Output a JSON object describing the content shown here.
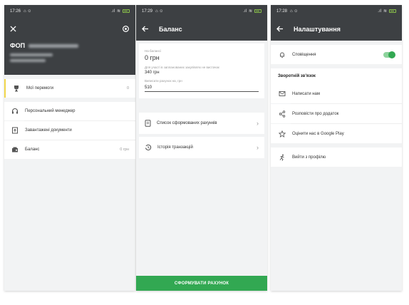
{
  "screens": [
    {
      "status": {
        "time": "17:26"
      },
      "header": {
        "title": "ФОП"
      },
      "menu": [
        {
          "label": "Мої перемоги",
          "value": "0"
        },
        {
          "label": "Персональний менеджер",
          "value": ""
        },
        {
          "label": "Завантажені документи",
          "value": ""
        },
        {
          "label": "Баланс",
          "value": "0 грн"
        }
      ]
    },
    {
      "status": {
        "time": "17:29"
      },
      "header": {
        "title": "Баланс"
      },
      "balance": {
        "label": "На балансі",
        "value": "0 грн",
        "participation_label": "Для участі в запланованих закупівлях не вистачає",
        "participation_value": "340 грн",
        "invoice_label": "Виписати рахунок на, грн",
        "invoice_value": "510"
      },
      "links": [
        {
          "label": "Список сформованих рахунків"
        },
        {
          "label": "Історія транзакцій"
        }
      ],
      "cta": "СФОРМУВАТИ РАХУНОК"
    },
    {
      "status": {
        "time": "17:28"
      },
      "header": {
        "title": "Налаштування"
      },
      "notifications_label": "Сповіщення",
      "notifications_on": true,
      "feedback_title": "Зворотній зв'язок",
      "feedback": [
        {
          "label": "Написати нам",
          "icon": "mail-icon"
        },
        {
          "label": "Розповісти про додаток",
          "icon": "share-icon"
        },
        {
          "label": "Оцінити нас в Google Play",
          "icon": "star-icon"
        }
      ],
      "logout_label": "Вийти з профілю"
    }
  ],
  "colors": {
    "appbar": "#3d4043",
    "accent_green": "#32a852",
    "background": "#f2f3f4"
  }
}
